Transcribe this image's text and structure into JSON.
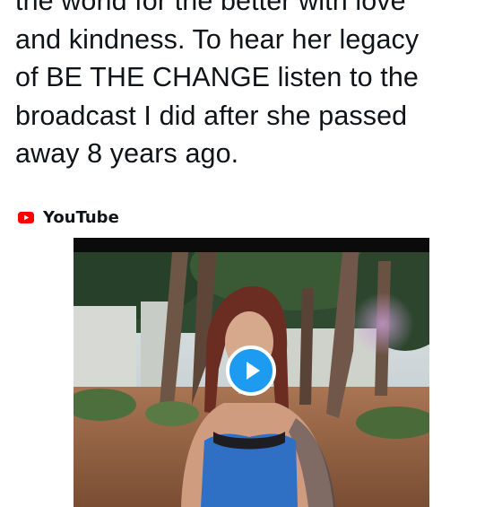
{
  "tweet": {
    "lines": [
      "the world for the better with love",
      "and kindness. To hear her legacy",
      "of BE THE CHANGE listen to the",
      "broadcast I did after she passed",
      "away 8 years ago."
    ]
  },
  "link_card": {
    "source": "YouTube",
    "source_icon": "youtube-logo-icon",
    "play_icon": "play-icon",
    "colors": {
      "youtube_red": "#ff0000",
      "play_blue": "#1d9bf0",
      "text": "#0f1419"
    }
  }
}
